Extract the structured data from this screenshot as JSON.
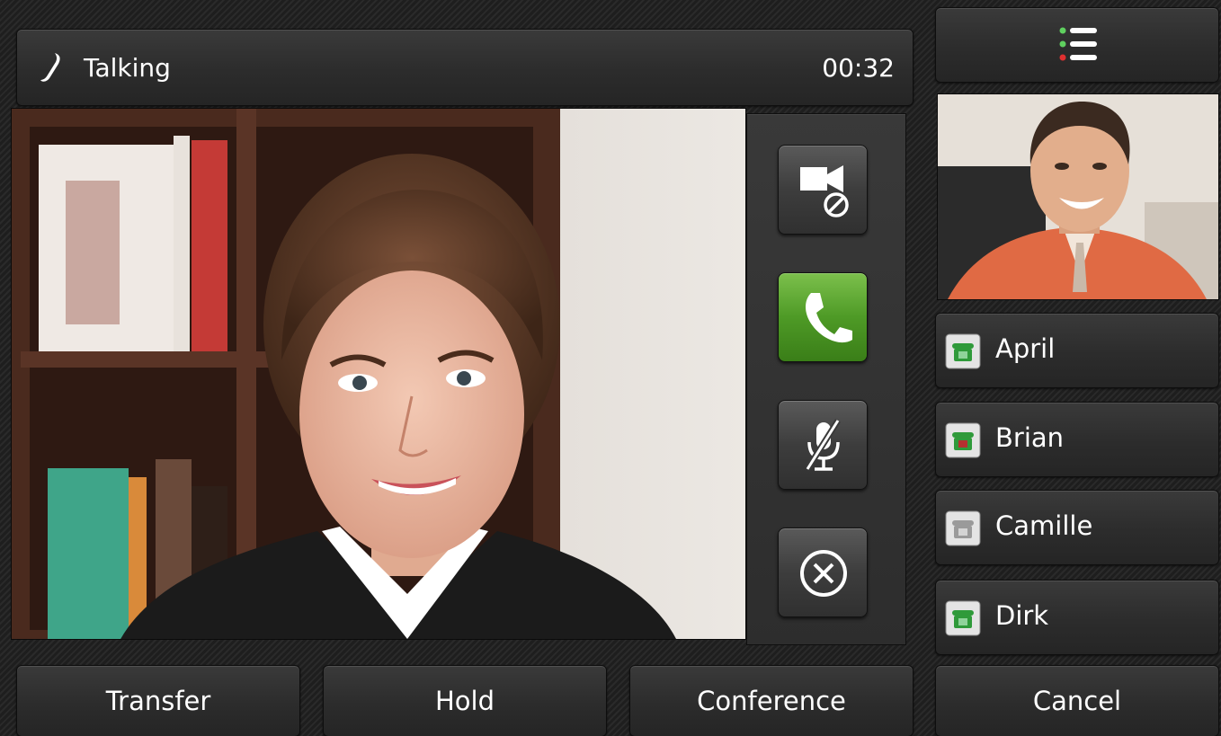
{
  "header": {
    "status": "Talking",
    "timer": "00:32",
    "icon": "handset-icon"
  },
  "controls": [
    {
      "name": "video-off",
      "icon": "camera-off-icon"
    },
    {
      "name": "answer",
      "icon": "phone-icon",
      "color": "#4e9a26"
    },
    {
      "name": "mute",
      "icon": "mic-muted-icon"
    },
    {
      "name": "end",
      "icon": "close-circle-icon"
    }
  ],
  "menu": {
    "icon": "list-icon",
    "dot_colors": [
      "#5fd05f",
      "#5fd05f",
      "#e03030"
    ]
  },
  "contacts": [
    {
      "name": "April",
      "status": "online",
      "color": "#2f9a3a"
    },
    {
      "name": "Brian",
      "status": "busy",
      "color": "#2f9a3a"
    },
    {
      "name": "Camille",
      "status": "offline",
      "color": "#9a9a9a"
    },
    {
      "name": "Dirk",
      "status": "online",
      "color": "#2f9a3a"
    }
  ],
  "softkeys": {
    "transfer": "Transfer",
    "hold": "Hold",
    "conference": "Conference",
    "cancel": "Cancel"
  }
}
